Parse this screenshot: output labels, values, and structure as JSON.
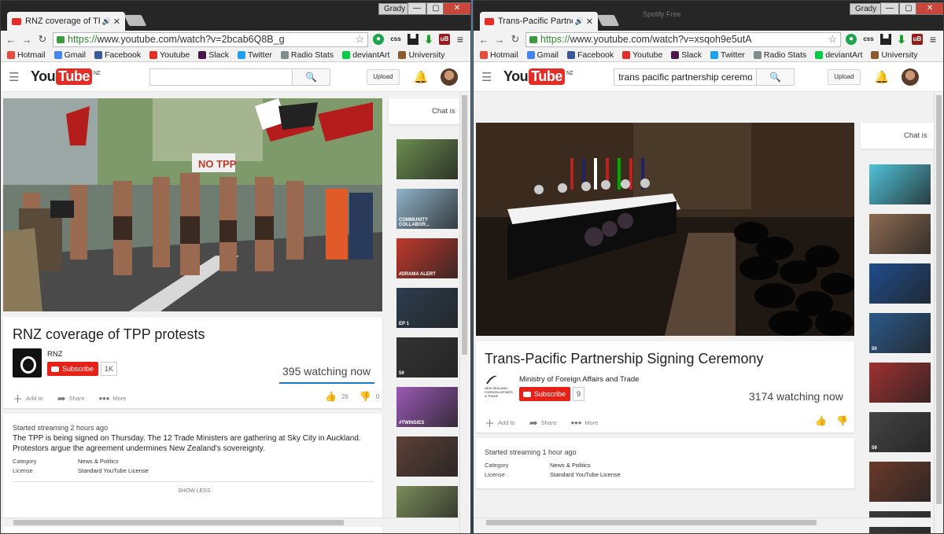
{
  "desktop": {
    "user_left": "Grady",
    "user_right": "Grady",
    "ghost_title": "Spotify Free"
  },
  "left": {
    "tab_title": "RNZ coverage of TPP p",
    "url_https": "https://",
    "url_rest": "www.youtube.com/watch?v=2bcab6Q8B_g",
    "search_value": "",
    "upload": "Upload",
    "chat_label": "Chat is",
    "video_title": "RNZ coverage of TPP protests",
    "channel": "RNZ",
    "subscribe": "Subscribe",
    "subs": "1K",
    "watching": "395 watching now",
    "add_to": "Add to",
    "share": "Share",
    "more": "More",
    "likes": "26",
    "dislikes": "0",
    "started": "Started streaming 2 hours ago",
    "description": "The TPP is being signed on Thursday. The 12 Trade Ministers are gathering at Sky City in Auckland. Protestors argue the agreement undermines New Zealand's sovereignty.",
    "category_label": "Category",
    "category_value": "News & Politics",
    "license_label": "License",
    "license_value": "Standard YouTube License",
    "show_less": "SHOW LESS",
    "thumbs": [
      {
        "label": "",
        "color": "#6b8e4e"
      },
      {
        "label": "COMMUNITY COLLABOR...",
        "color": "#8fb3c9"
      },
      {
        "label": "#DRAMA ALERT",
        "color": "#c0392b"
      },
      {
        "label": "EP 1",
        "color": "#2c3e50"
      },
      {
        "label": "59",
        "color": "#333333"
      },
      {
        "label": "#TWINSIES",
        "color": "#9b59b6"
      },
      {
        "label": "",
        "color": "#5d4037"
      },
      {
        "label": "",
        "color": "#7b8d5a"
      }
    ]
  },
  "right": {
    "tab_title": "Trans-Pacific Partnersh",
    "url_https": "https://",
    "url_rest": "www.youtube.com/watch?v=xsqoh9e5utA",
    "search_value": "trans pacific partnership ceremo",
    "upload": "Upload",
    "chat_label": "Chat is",
    "video_title": "Trans-Pacific Partnership Signing Ceremony",
    "channel": "Ministry of Foreign Affairs and Trade",
    "mfat_logo_text": "NEW ZEALAND FOREIGN AFFAIRS & TRADE",
    "subscribe": "Subscribe",
    "subs": "9",
    "watching": "3174 watching now",
    "add_to": "Add to",
    "share": "Share",
    "more": "More",
    "started": "Started streaming 1 hour ago",
    "category_label": "Category",
    "category_value": "News & Politics",
    "license_label": "License",
    "license_value": "Standard YouTube License",
    "thumbs": [
      {
        "label": "",
        "color": "#4fc3d9"
      },
      {
        "label": "",
        "color": "#8e6b52"
      },
      {
        "label": "",
        "color": "#1e4d8c"
      },
      {
        "label": "50",
        "color": "#2a5a8a"
      },
      {
        "label": "",
        "color": "#a03030"
      },
      {
        "label": "59",
        "color": "#444444"
      },
      {
        "label": "",
        "color": "#6a3a2a"
      },
      {
        "label": "",
        "color": "#3a3a3a"
      }
    ]
  },
  "bookmarks": [
    {
      "label": "Hotmail",
      "icon": "windows-icon",
      "color": "#e74c3c"
    },
    {
      "label": "Gmail",
      "icon": "google-icon",
      "color": "#4285f4"
    },
    {
      "label": "Facebook",
      "icon": "facebook-icon",
      "color": "#3b5998"
    },
    {
      "label": "Youtube",
      "icon": "youtube-icon",
      "color": "#e52d27"
    },
    {
      "label": "Slack",
      "icon": "slack-icon",
      "color": "#4a154b"
    },
    {
      "label": "Twitter",
      "icon": "twitter-icon",
      "color": "#1da1f2"
    },
    {
      "label": "Radio Stats",
      "icon": "radio-icon",
      "color": "#7f8c8d"
    },
    {
      "label": "deviantArt",
      "icon": "deviantart-icon",
      "color": "#05cc47"
    },
    {
      "label": "University",
      "icon": "university-icon",
      "color": "#8b5a2b"
    }
  ],
  "toolbar": {
    "ext_css": "css"
  }
}
